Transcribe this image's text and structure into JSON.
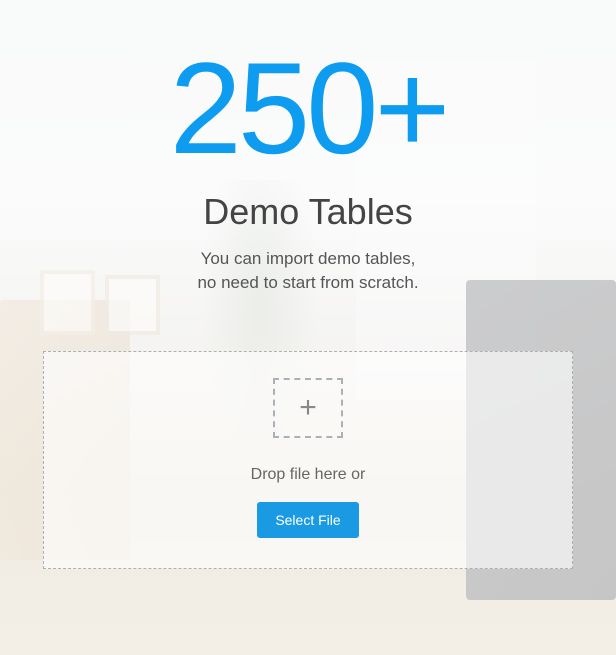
{
  "hero": {
    "number": "250+",
    "title": "Demo Tables",
    "subtitle_line1": "You can import demo tables,",
    "subtitle_line2": "no need to start from scratch."
  },
  "dropzone": {
    "plus_symbol": "+",
    "drop_text": "Drop file here or",
    "button_label": "Select File"
  },
  "colors": {
    "accent": "#0e9cf0",
    "button": "#1b9ae4",
    "text_dark": "#444444",
    "text_muted": "#666666"
  }
}
